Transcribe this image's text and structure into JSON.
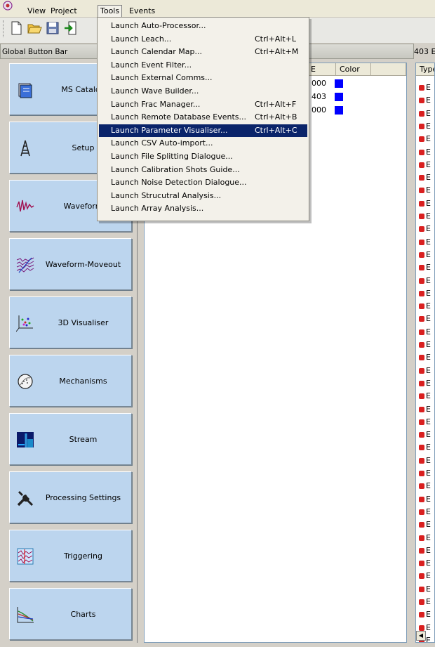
{
  "menubar": {
    "items": [
      "View",
      "Project",
      "Tools",
      "Events"
    ]
  },
  "global_bar": {
    "title": "Global Button Bar",
    "buttons": [
      {
        "label": "MS Catalog",
        "icon": "catalog-icon"
      },
      {
        "label": "Setup",
        "icon": "tower-icon"
      },
      {
        "label": "Waveform",
        "icon": "waveform-icon"
      },
      {
        "label": "Waveform-Moveout",
        "icon": "moveout-icon"
      },
      {
        "label": "3D Visualiser",
        "icon": "scatter-3d-icon"
      },
      {
        "label": "Mechanisms",
        "icon": "beachball-icon"
      },
      {
        "label": "Stream",
        "icon": "stream-icon"
      },
      {
        "label": "Processing Settings",
        "icon": "tools-icon"
      },
      {
        "label": "Triggering",
        "icon": "trigger-icon"
      },
      {
        "label": "Charts",
        "icon": "chart-icon"
      }
    ]
  },
  "center": {
    "columns": [
      "E",
      "Color"
    ],
    "rows": [
      {
        "value": "000",
        "color": "#0000ff"
      },
      {
        "value": "403",
        "color": "#0000ff"
      },
      {
        "value": "000",
        "color": "#0000ff"
      }
    ]
  },
  "right": {
    "header": "403 E",
    "column": "Type",
    "row_prefix": "E"
  },
  "tools_menu": {
    "items": [
      {
        "label": "Launch Auto-Processor...",
        "shortcut": ""
      },
      {
        "label": "Launch Leach...",
        "shortcut": "Ctrl+Alt+L"
      },
      {
        "label": "Launch Calendar Map...",
        "shortcut": "Ctrl+Alt+M"
      },
      {
        "label": "Launch Event Filter...",
        "shortcut": ""
      },
      {
        "label": "Launch External Comms...",
        "shortcut": ""
      },
      {
        "label": "Launch Wave Builder...",
        "shortcut": ""
      },
      {
        "label": "Launch Frac Manager...",
        "shortcut": "Ctrl+Alt+F"
      },
      {
        "label": "Launch Remote Database Events...",
        "shortcut": "Ctrl+Alt+B"
      },
      {
        "label": "Launch Parameter Visualiser...",
        "shortcut": "Ctrl+Alt+C"
      },
      {
        "label": "Launch CSV Auto-import...",
        "shortcut": ""
      },
      {
        "label": "Launch File Splitting Dialogue...",
        "shortcut": ""
      },
      {
        "label": "Launch Calibration Shots Guide...",
        "shortcut": ""
      },
      {
        "label": "Launch Noise Detection Dialogue...",
        "shortcut": ""
      },
      {
        "label": "Launch Strucutral Analysis...",
        "shortcut": ""
      },
      {
        "label": "Launch Array Analysis...",
        "shortcut": ""
      }
    ],
    "selected_index": 8
  },
  "colors": {
    "button_face": "#bcd5ee",
    "menu_highlight": "#0a246a",
    "event_color": "#0000ff"
  }
}
